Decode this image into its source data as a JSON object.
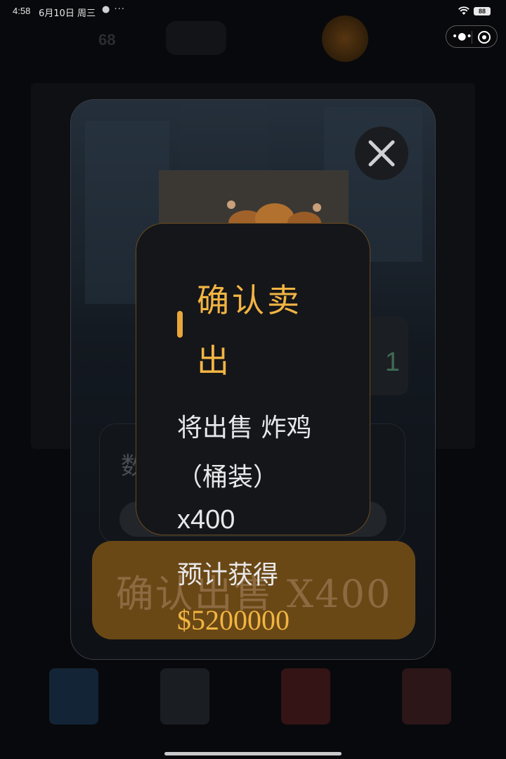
{
  "status_bar": {
    "time": "4:58",
    "date": "6月10日 周三",
    "battery": "88"
  },
  "background": {
    "balance_number": "68"
  },
  "card": {
    "count_value": "1",
    "quantity_label": "数",
    "confirm_button": "确认出售 X400"
  },
  "dialog": {
    "title": "确认卖出",
    "message": "将出售 炸鸡（桶装）",
    "quantity": "x400",
    "earn_label": "预计获得",
    "earn_value": "$5200000"
  },
  "colors": {
    "accent": "#f2b542",
    "button": "#6a4816"
  }
}
